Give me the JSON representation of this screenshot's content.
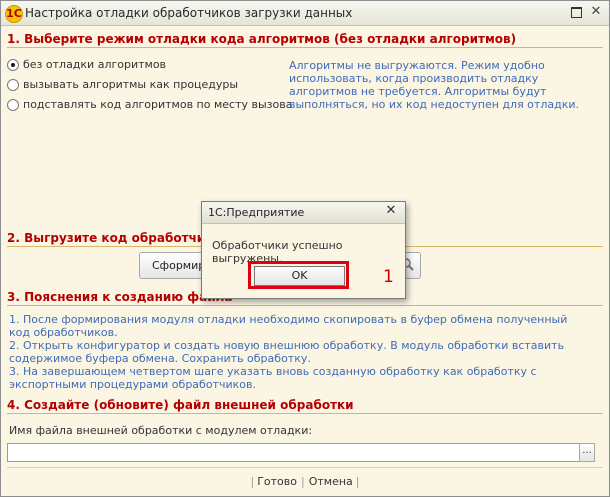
{
  "window": {
    "title": "Настройка отладки обработчиков загрузки данных",
    "app_icon_glyph": "1C"
  },
  "section1": {
    "header": "1. Выберите режим отладки кода алгоритмов (без отладки алгоритмов)",
    "options": [
      {
        "label": "без отладки алгоритмов",
        "checked": true
      },
      {
        "label": "вызывать алгоритмы как процедуры",
        "checked": false
      },
      {
        "label": "подставлять код алгоритмов по месту вызова",
        "checked": false
      }
    ],
    "hint_lines": [
      "Алгоритмы не выгружаются. Режим удобно",
      "использовать, когда производить отладку",
      "алгоритмов не требуется. Алгоритмы будут",
      "выполняться, но их код недоступен для отладки."
    ]
  },
  "section2": {
    "header": "2. Выгрузите код обработчиков",
    "button_label": "Сформир"
  },
  "section3": {
    "header": "3. Пояснения к созданию файла",
    "lines": [
      "1. После формирования модуля отладки необходимо скопировать в буфер обмена полученный",
      "код обработчиков.",
      "2. Открыть конфигуратор и создать новую внешнюю обработку. В модуль обработки вставить",
      "содержимое буфера обмена. Сохранить обработку.",
      "3. На завершающем четвертом шаге указать вновь созданную обработку как обработку с",
      "экспортными процедурами обработчиков."
    ]
  },
  "section4": {
    "header": "4. Создайте (обновите) файл внешней обработки",
    "file_label": "Имя файла внешней обработки с модулем отладки:",
    "file_value": "",
    "browse_label": "..."
  },
  "footer": {
    "done_label": "Готово",
    "cancel_label": "Отмена",
    "separator": "|"
  },
  "modal": {
    "title": "1С:Предприятие",
    "message": "Обработчики успешно выгружены.",
    "ok_label": "OK"
  },
  "annotation": {
    "marker": "1"
  },
  "colors": {
    "section_header": "#b60000",
    "hint_text": "#3f6ab8",
    "highlight": "#e0000f",
    "window_bg": "#fbf6e4"
  }
}
